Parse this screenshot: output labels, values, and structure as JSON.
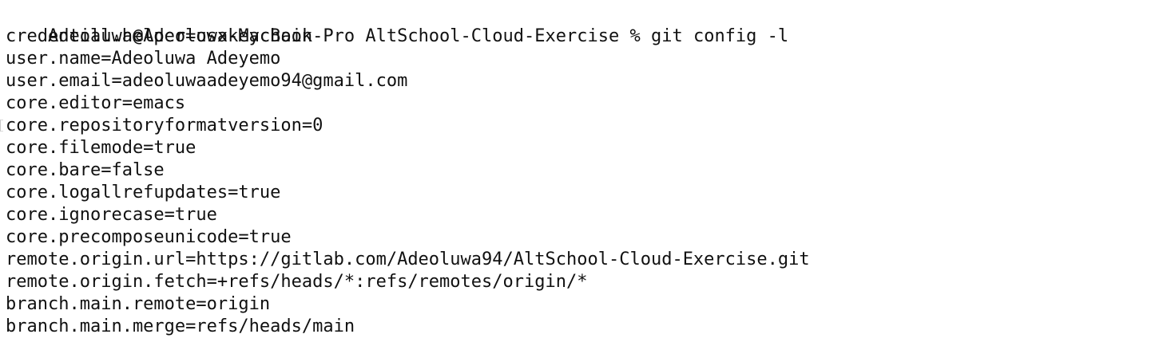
{
  "terminal": {
    "prompt": "Adeoluwa@Adeoluwa-MacBook-Pro AltSchool-Cloud-Exercise % ",
    "command": "git config -l",
    "output": [
      "credential.helper=osxkeychain",
      "user.name=Adeoluwa Adeyemo",
      "user.email=adeoluwaadeyemo94@gmail.com",
      "core.editor=emacs",
      "core.repositoryformatversion=0",
      "core.filemode=true",
      "core.bare=false",
      "core.logallrefupdates=true",
      "core.ignorecase=true",
      "core.precomposeunicode=true",
      "remote.origin.url=https://gitlab.com/Adeoluwa94/AltSchool-Cloud-Exercise.git",
      "remote.origin.fetch=+refs/heads/*:refs/remotes/origin/*",
      "branch.main.remote=origin",
      "branch.main.merge=refs/heads/main"
    ]
  },
  "colors": {
    "background": "#ffffff",
    "text": "#111111"
  }
}
